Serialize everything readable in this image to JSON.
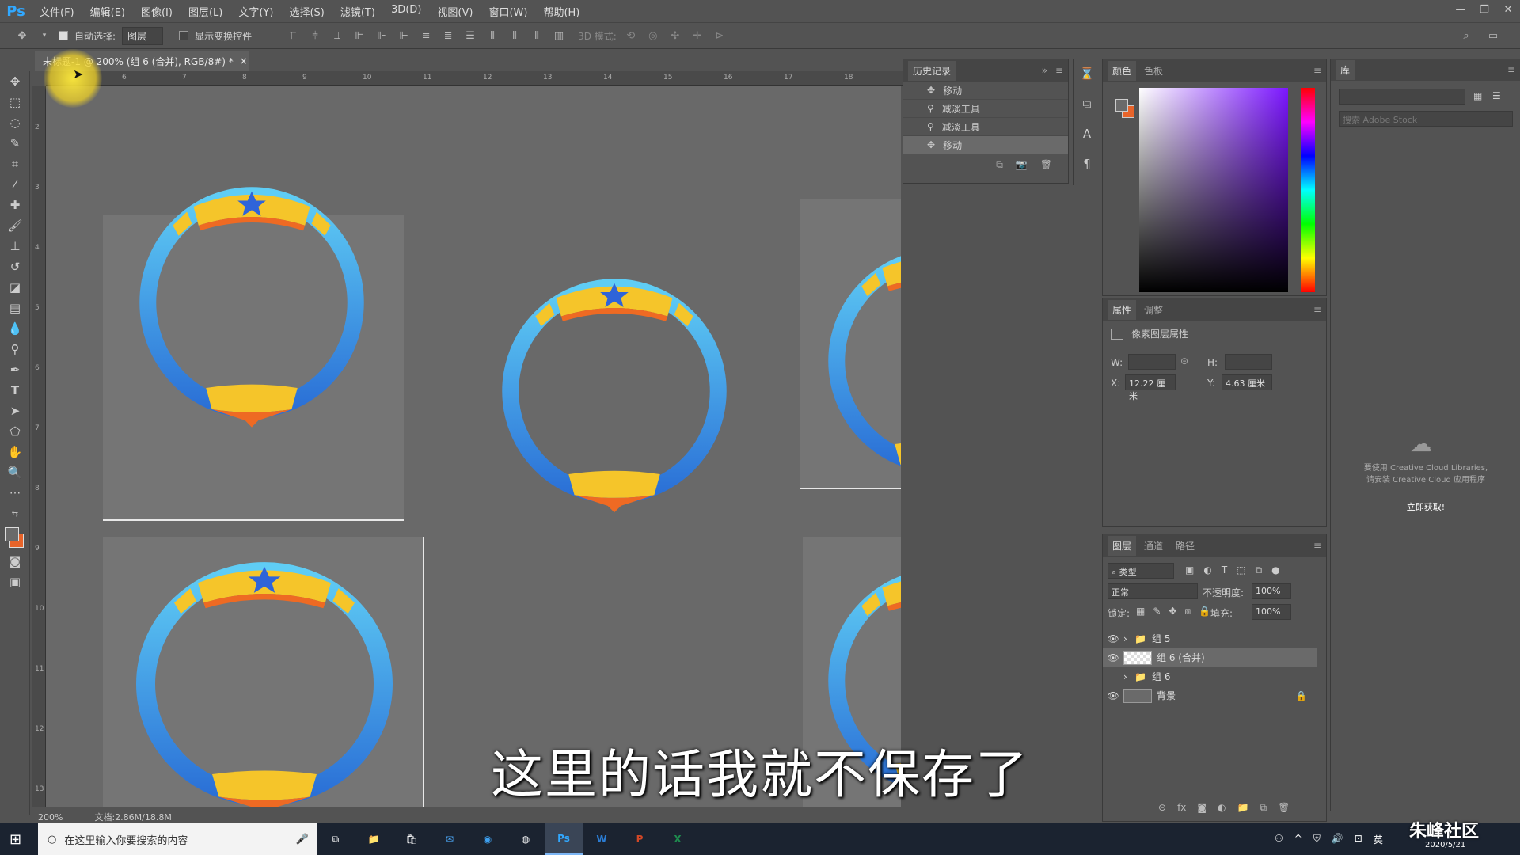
{
  "app": {
    "logo": "Ps"
  },
  "menu": [
    "文件(F)",
    "编辑(E)",
    "图像(I)",
    "图层(L)",
    "文字(Y)",
    "选择(S)",
    "滤镜(T)",
    "3D(D)",
    "视图(V)",
    "窗口(W)",
    "帮助(H)"
  ],
  "options": {
    "auto_select_label": "自动选择:",
    "auto_select_value": "图层",
    "show_transform_label": "显示变换控件",
    "mode3d_label": "3D 模式:"
  },
  "doc_tab": {
    "title": "未标题-1 @ 200% (组 6 (合并), RGB/8#) *",
    "close": "×"
  },
  "ruler_top": [
    "6",
    "7",
    "8",
    "9",
    "10",
    "11",
    "12",
    "13",
    "14",
    "15",
    "16",
    "17",
    "18"
  ],
  "ruler_left": [
    "2",
    "3",
    "4",
    "5",
    "6",
    "7",
    "8",
    "9",
    "10",
    "11",
    "12",
    "13"
  ],
  "history": {
    "tab": "历史记录",
    "items": [
      "移动",
      "减淡工具",
      "减淡工具",
      "移动"
    ]
  },
  "color_panel": {
    "tabs": [
      "颜色",
      "色板"
    ],
    "fg": "#6a6a6a",
    "bg": "#e8642a"
  },
  "properties": {
    "tabs": [
      "属性",
      "调整"
    ],
    "title": "像素图层属性",
    "w_label": "W:",
    "h_label": "H:",
    "x_label": "X:",
    "x_value": "12.22 厘米",
    "y_label": "Y:",
    "y_value": "4.63 厘米"
  },
  "library": {
    "tab": "库",
    "search_placeholder": "搜索 Adobe Stock",
    "message1": "要使用 Creative Cloud Libraries,",
    "message2": "请安装 Creative Cloud 应用程序",
    "link": "立即获取!"
  },
  "layers": {
    "tabs": [
      "图层",
      "通道",
      "路径"
    ],
    "filter_label": "类型",
    "blend_mode": "正常",
    "opacity_label": "不透明度:",
    "opacity_value": "100%",
    "lock_label": "锁定:",
    "fill_label": "填充:",
    "fill_value": "100%",
    "rows": [
      {
        "name": "组 5",
        "type": "group",
        "visible": true
      },
      {
        "name": "组 6 (合并)",
        "type": "pixel",
        "visible": true,
        "selected": true
      },
      {
        "name": "组 6",
        "type": "group",
        "visible": false
      },
      {
        "name": "背景",
        "type": "background",
        "visible": true,
        "locked": true
      }
    ]
  },
  "status": {
    "zoom": "200%",
    "doc": "文档:2.86M/18.8M"
  },
  "subtitle": "这里的话我就不保存了",
  "taskbar": {
    "search_placeholder": "在这里输入你要搜索的内容",
    "ime": "英",
    "date": "2020/5/21"
  },
  "watermark": "朱峰社区",
  "colors": {
    "ring_blue": "#3aa9ee",
    "ring_dark": "#2a6fd6",
    "ring_gold": "#f5c52a",
    "ring_orange": "#ee6a23",
    "star": "#2f64d9"
  }
}
